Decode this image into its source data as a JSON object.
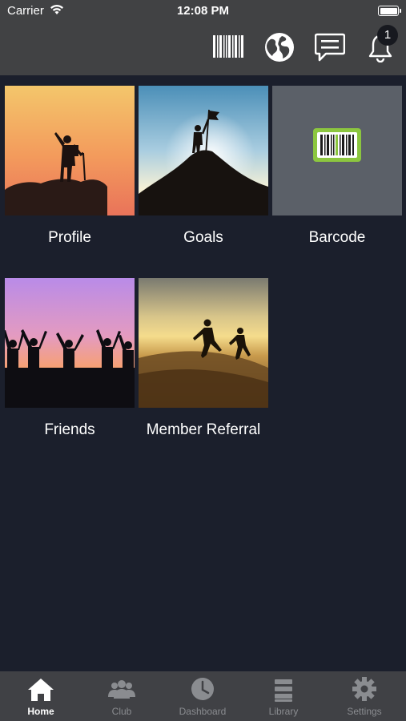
{
  "status_bar": {
    "carrier": "Carrier",
    "time": "12:08 PM"
  },
  "header": {
    "icons": [
      "barcode-icon",
      "globe-icon",
      "chat-icon",
      "bell-icon"
    ],
    "notification_count": "1"
  },
  "tiles": [
    {
      "label": "Profile"
    },
    {
      "label": "Goals"
    },
    {
      "label": "Barcode"
    },
    {
      "label": "Friends"
    },
    {
      "label": "Member Referral"
    }
  ],
  "tabbar": {
    "items": [
      {
        "label": "Home",
        "icon": "home-icon",
        "active": true
      },
      {
        "label": "Club",
        "icon": "people-icon",
        "active": false
      },
      {
        "label": "Dashboard",
        "icon": "clock-icon",
        "active": false
      },
      {
        "label": "Library",
        "icon": "library-icon",
        "active": false
      },
      {
        "label": "Settings",
        "icon": "gear-icon",
        "active": false
      }
    ]
  },
  "colors": {
    "background": "#1b1f2c",
    "header": "#414244",
    "tabbar": "#404145",
    "barcode_accent": "#8cc63f"
  }
}
